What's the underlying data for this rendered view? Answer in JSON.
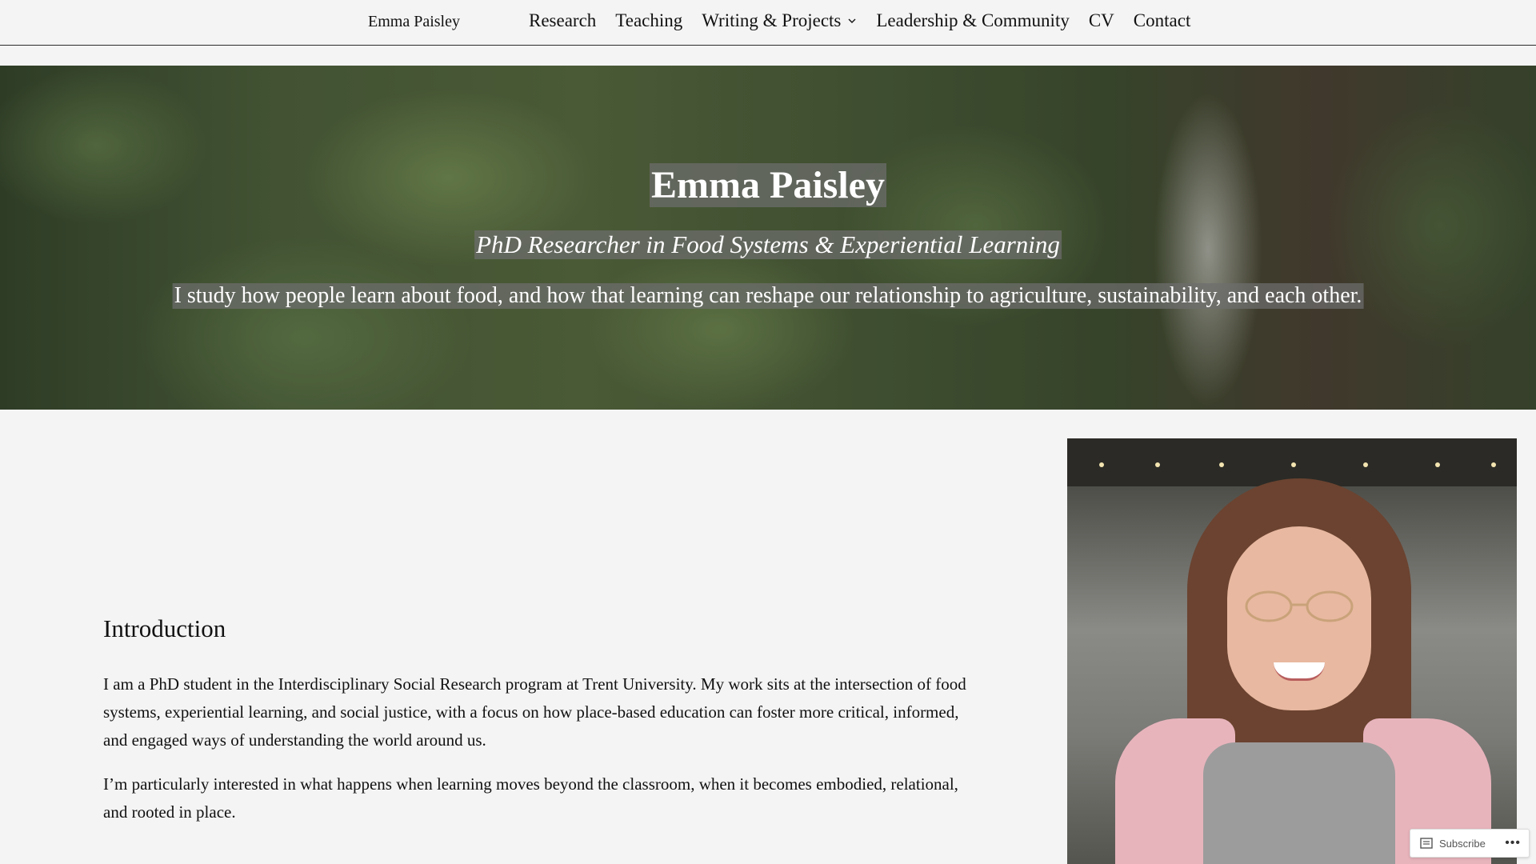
{
  "header": {
    "site_title": "Emma Paisley",
    "nav": [
      {
        "label": "Research"
      },
      {
        "label": "Teaching"
      },
      {
        "label": "Writing & Projects",
        "has_dropdown": true
      },
      {
        "label": "Leadership & Community"
      },
      {
        "label": "CV"
      },
      {
        "label": "Contact"
      }
    ]
  },
  "hero": {
    "title": "Emma Paisley",
    "subtitle": "PhD Researcher in Food Systems & Experiential Learning",
    "tagline": "I study how people learn about food, and how that learning can reshape our relationship to agriculture, sustainability, and each other."
  },
  "intro": {
    "heading": "Introduction",
    "paragraphs": [
      "I am a PhD student in the Interdisciplinary Social Research program at Trent University. My work sits at the intersection of food systems, experiential learning, and social justice, with a focus on how place-based education can foster more critical, informed, and engaged ways of understanding the world around us.",
      "I’m particularly interested in what happens when learning moves beyond the classroom, when it becomes embodied, relational, and rooted in place."
    ]
  },
  "subscribe": {
    "label": "Subscribe",
    "more": "•••"
  },
  "icons": {
    "chevron": "chevron-down-icon",
    "subscribe": "reader-icon",
    "more": "ellipsis-icon"
  }
}
